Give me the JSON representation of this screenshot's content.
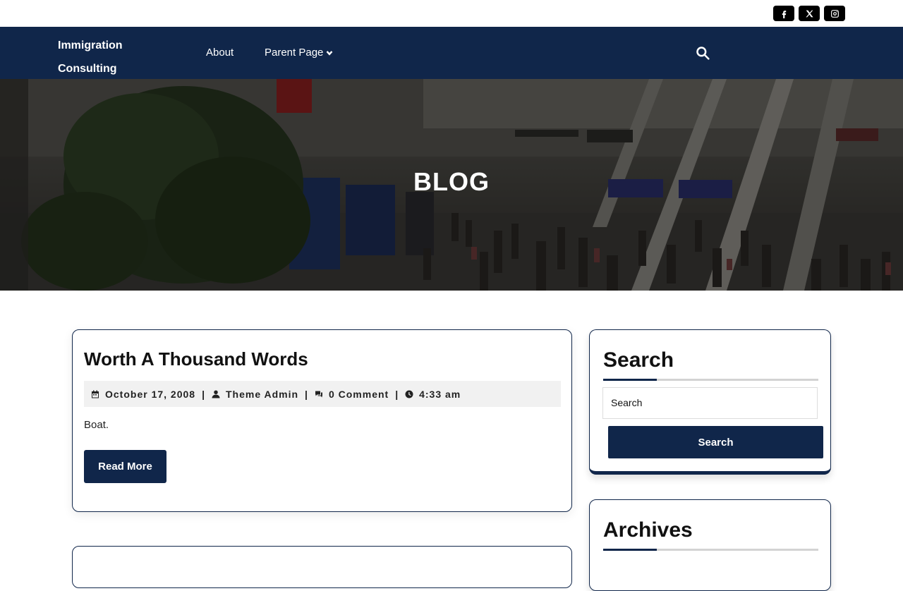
{
  "social": {
    "icons": [
      "facebook-icon",
      "x-twitter-icon",
      "instagram-icon"
    ]
  },
  "header": {
    "brand": "Immigration Consulting",
    "nav": {
      "about": "About",
      "parent_page": "Parent Page"
    }
  },
  "hero": {
    "title": "BLOG"
  },
  "post": {
    "title": "Worth A Thousand Words",
    "date": "October 17, 2008",
    "author": "Theme Admin",
    "comments": "0 Comment",
    "time": "4:33 am",
    "separator": "|",
    "excerpt": "Boat.",
    "read_more": "Read More"
  },
  "sidebar": {
    "search": {
      "title": "Search",
      "placeholder": "Search",
      "button": "Search"
    },
    "archives": {
      "title": "Archives"
    }
  },
  "colors": {
    "navy": "#10264a",
    "meta_bg": "#f1f1f1"
  }
}
